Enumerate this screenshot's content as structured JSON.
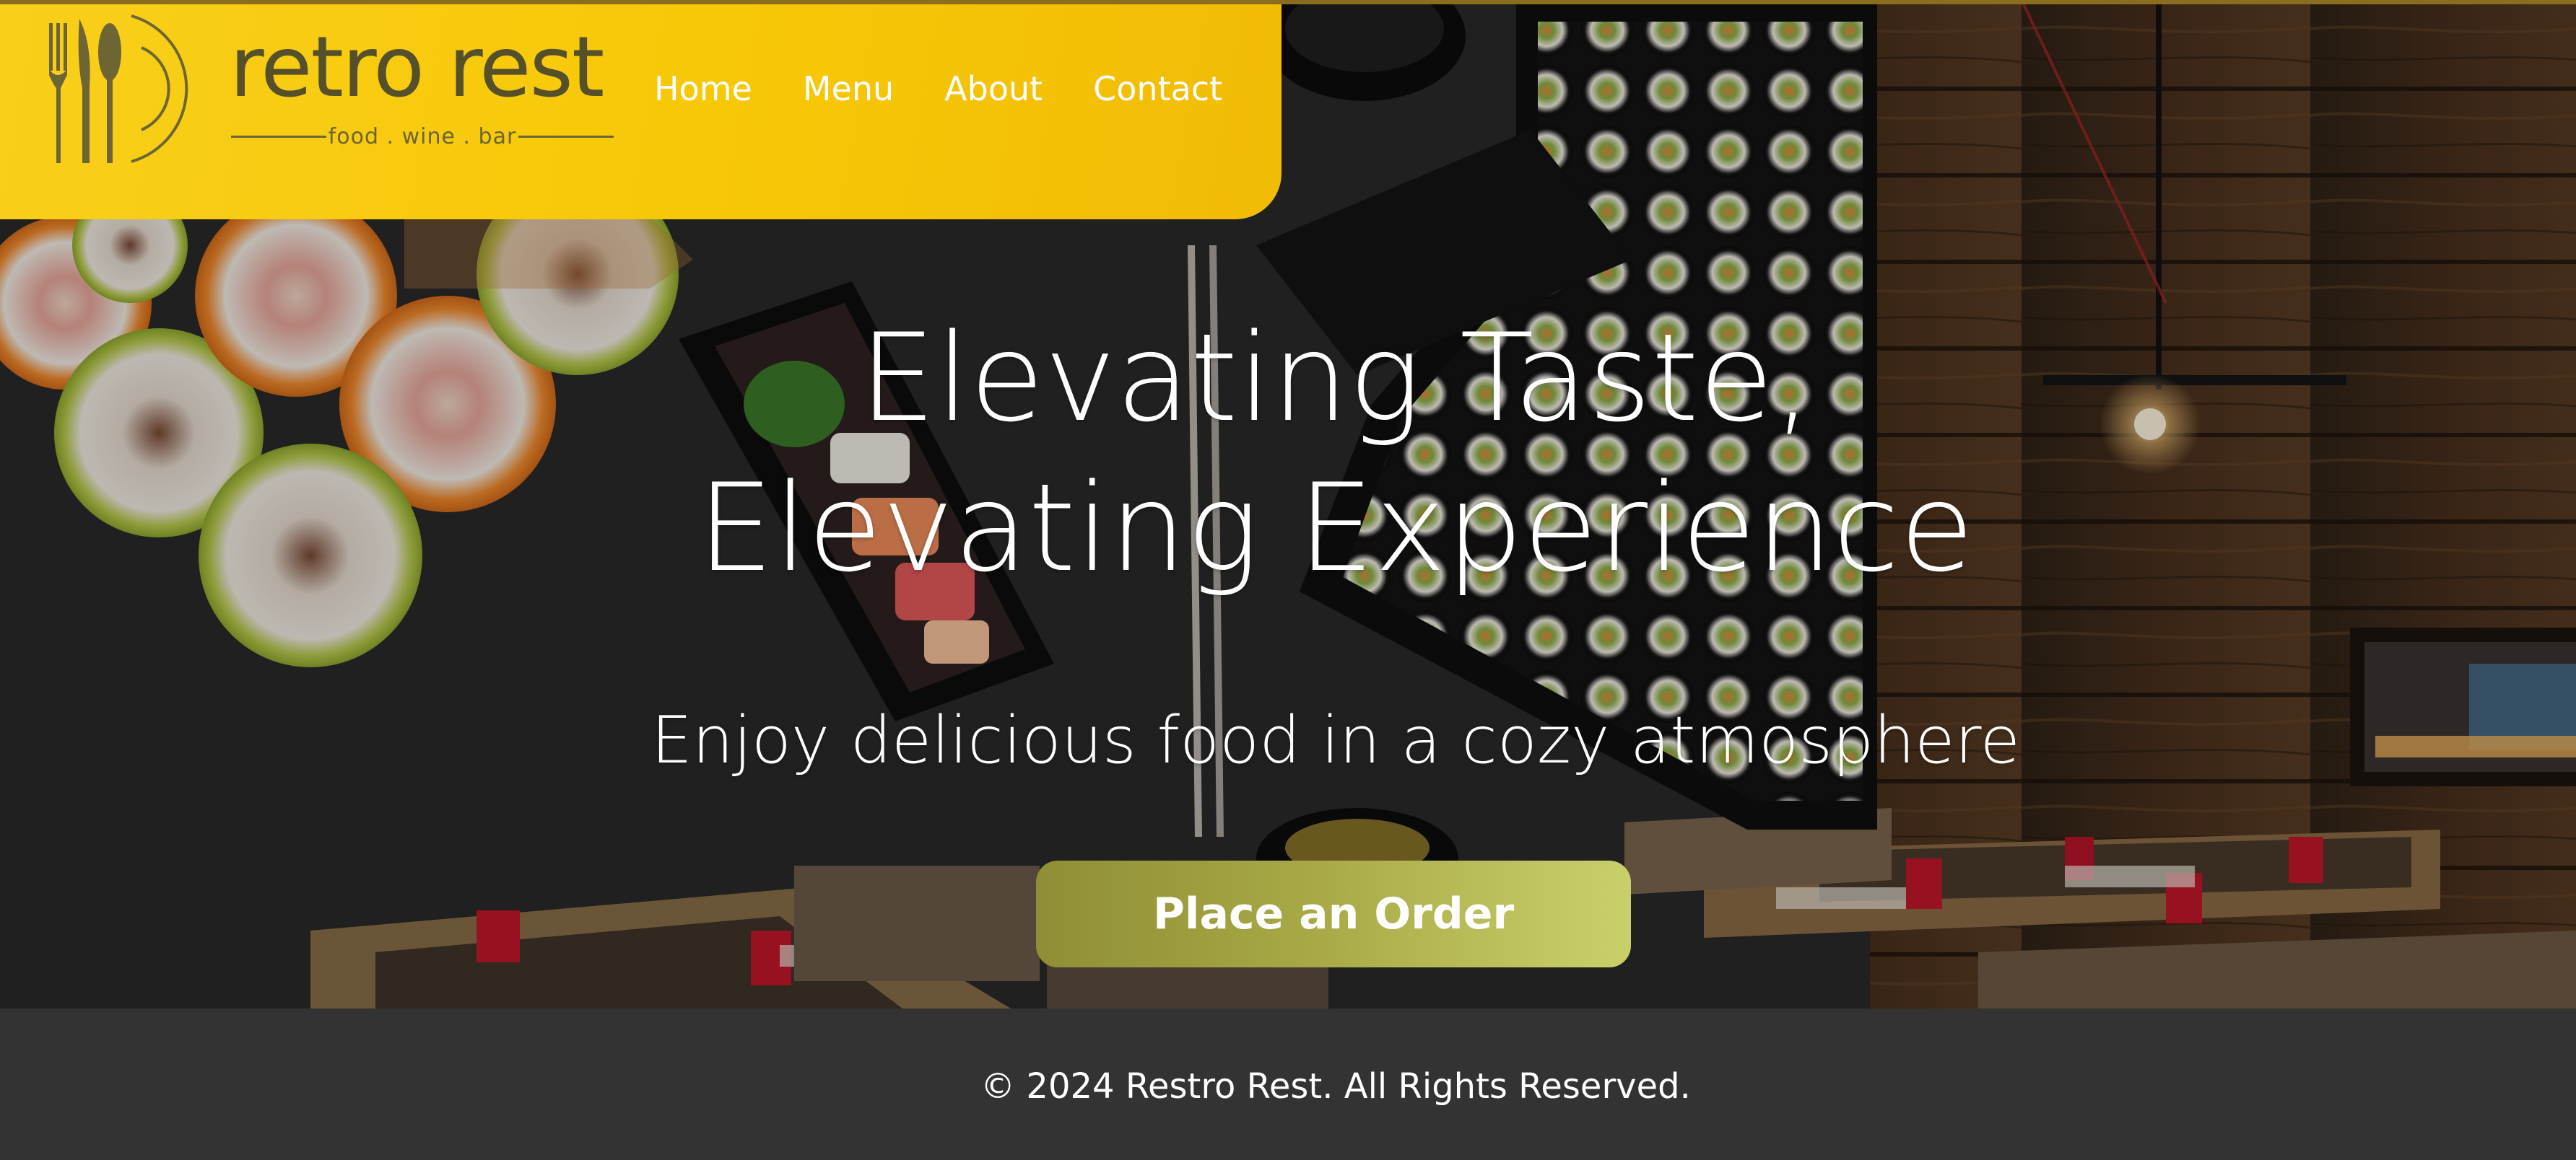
{
  "brand": {
    "name": "retro rest",
    "tagline": "food . wine . bar"
  },
  "nav": {
    "items": [
      {
        "label": "Home"
      },
      {
        "label": "Menu"
      },
      {
        "label": "About"
      },
      {
        "label": "Contact"
      }
    ]
  },
  "hero": {
    "title_line1": "Elevating Taste,",
    "title_line2": "Elevating Experience",
    "subtitle": "Enjoy delicious food in a cozy atmosphere",
    "cta_label": "Place an Order",
    "background_image": "sushi-and-restaurant-interior"
  },
  "footer": {
    "copyright": "© 2024 Restro Rest. All Rights Reserved."
  },
  "colors": {
    "header_gold": "#f7c807",
    "logo_olive": "#56502a",
    "cta_start": "#8f8e36",
    "cta_end": "#c9d06a",
    "footer_bg": "#333333",
    "text_white": "#ffffff"
  },
  "icons": {
    "logo_mark": "fork-knife-spoon-plate-icon"
  }
}
